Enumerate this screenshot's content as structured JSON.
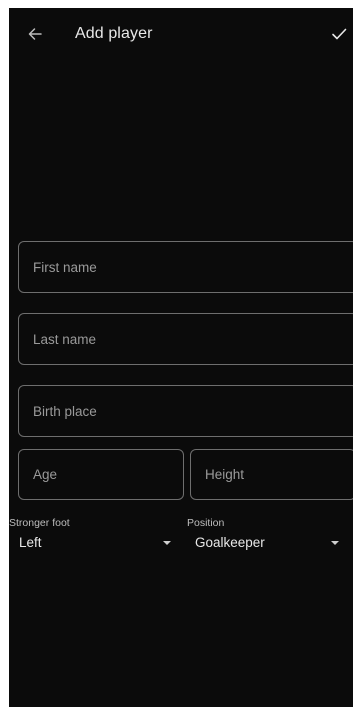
{
  "app_bar": {
    "title": "Add player",
    "back_icon": "arrow-left-icon",
    "confirm_icon": "check-icon"
  },
  "form": {
    "first_name": {
      "placeholder": "First name",
      "value": ""
    },
    "last_name": {
      "placeholder": "Last name",
      "value": ""
    },
    "birth_place": {
      "placeholder": "Birth place",
      "value": ""
    },
    "age": {
      "placeholder": "Age",
      "value": ""
    },
    "height": {
      "placeholder": "Height",
      "value": ""
    },
    "stronger_foot": {
      "label": "Stronger foot",
      "value": "Left"
    },
    "position": {
      "label": "Position",
      "value": "Goalkeeper"
    }
  },
  "colors": {
    "background": "#0b0b0b",
    "text": "#e8e8e8",
    "outline": "#6e6e6e",
    "placeholder": "#9a9a9a"
  }
}
